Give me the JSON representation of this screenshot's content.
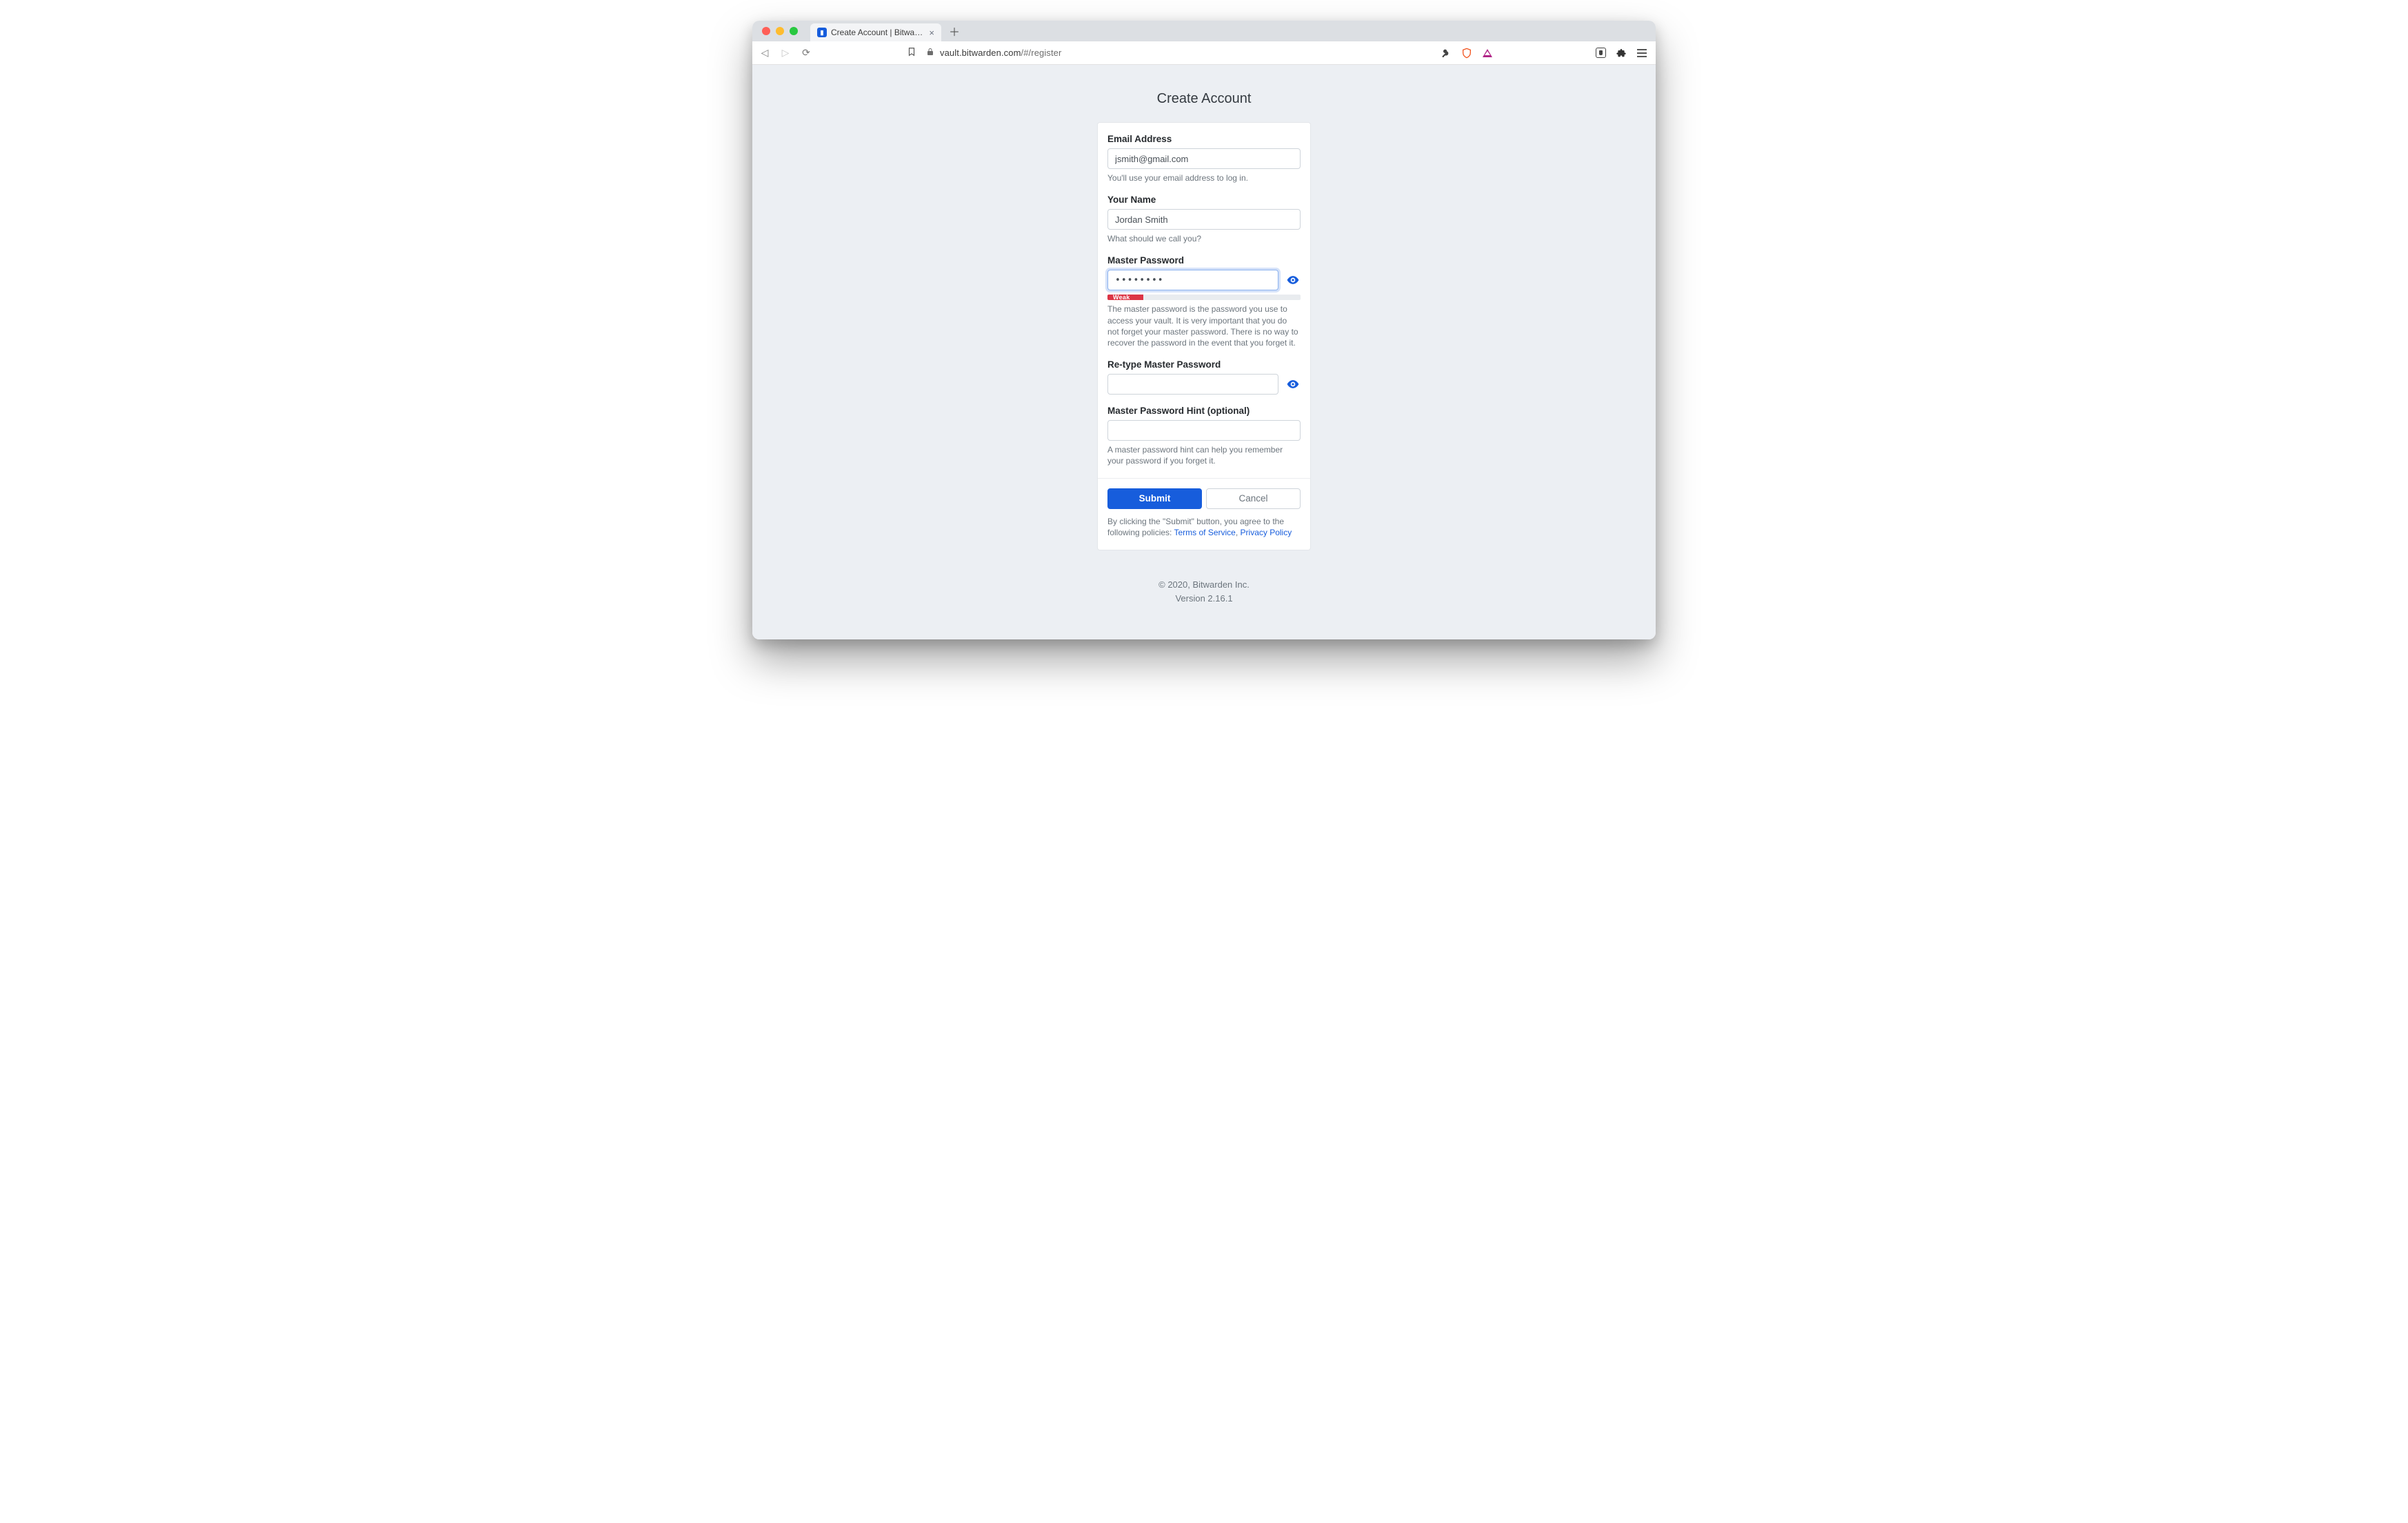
{
  "browser": {
    "tab_title": "Create Account | Bitwarden Web",
    "url_host": "vault.bitwarden.com",
    "url_rest": "/#/register"
  },
  "page": {
    "title": "Create Account"
  },
  "form": {
    "email": {
      "label": "Email Address",
      "value": "jsmith@gmail.com",
      "help": "You'll use your email address to log in."
    },
    "name": {
      "label": "Your Name",
      "value": "Jordan Smith",
      "help": "What should we call you?"
    },
    "password": {
      "label": "Master Password",
      "value": "••••••••",
      "strength_label": "Weak",
      "help": "The master password is the password you use to access your vault. It is very important that you do not forget your master password. There is no way to recover the password in the event that you forget it."
    },
    "retype": {
      "label": "Re-type Master Password",
      "value": ""
    },
    "hint": {
      "label": "Master Password Hint (optional)",
      "value": "",
      "help": "A master password hint can help you remember your password if you forget it."
    },
    "submit_label": "Submit",
    "cancel_label": "Cancel",
    "agree_prefix": "By clicking the \"Submit\" button, you agree to the following policies: ",
    "tos_label": "Terms of Service",
    "sep": ", ",
    "privacy_label": "Privacy Policy"
  },
  "footer": {
    "copyright": "© 2020, Bitwarden Inc.",
    "version": "Version 2.16.1"
  }
}
